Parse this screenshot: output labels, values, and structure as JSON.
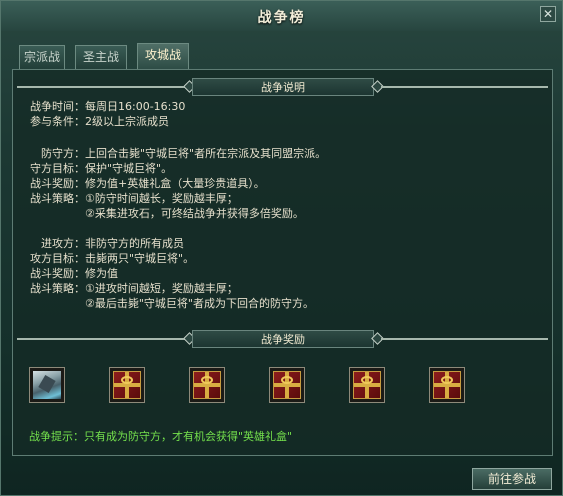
{
  "window": {
    "title": "战争榜",
    "close_label": "✕"
  },
  "tabs": [
    {
      "label": "宗派战",
      "active": false
    },
    {
      "label": "圣主战",
      "active": false
    },
    {
      "label": "攻城战",
      "active": true
    }
  ],
  "description": {
    "header": "战争说明",
    "general": [
      {
        "label": "战争时间：",
        "value": "每周日16:00-16:30"
      },
      {
        "label": "参与条件：",
        "value": "2级以上宗派成员"
      }
    ],
    "defender": [
      {
        "label": "防守方：",
        "value": "上回合击毙\"守城巨将\"者所在宗派及其同盟宗派。"
      },
      {
        "label": "守方目标：",
        "value": "保护\"守城巨将\"。"
      },
      {
        "label": "战斗奖励：",
        "value": "修为值+英雄礼盒（大量珍贵道具）。"
      },
      {
        "label": "战斗策略：",
        "value": "①防守时间越长，奖励越丰厚；"
      },
      {
        "label": "",
        "value": "②采集进攻石，可终结战争并获得多倍奖励。"
      }
    ],
    "attacker": [
      {
        "label": "进攻方：",
        "value": "非防守方的所有成员"
      },
      {
        "label": "攻方目标：",
        "value": "击毙两只\"守城巨将\"。"
      },
      {
        "label": "战斗奖励：",
        "value": "修为值"
      },
      {
        "label": "战斗策略：",
        "value": "①进攻时间越短，奖励越丰厚；"
      },
      {
        "label": "",
        "value": "②最后击毙\"守城巨将\"者成为下回合的防守方。"
      }
    ]
  },
  "rewards": {
    "header": "战争奖励",
    "items": [
      {
        "icon": "crystal-stone-icon"
      },
      {
        "icon": "gift-box-icon"
      },
      {
        "icon": "gift-box-icon"
      },
      {
        "icon": "gift-box-icon"
      },
      {
        "icon": "gift-box-icon"
      },
      {
        "icon": "gift-box-icon"
      }
    ]
  },
  "tip": "战争提示：只有成为防守方，才有机会获得\"英雄礼盒\"",
  "join_button": "前往参战",
  "colors": {
    "tip_text": "#74e04c",
    "panel_bg": "#15302b",
    "accent": "#d8ad42"
  }
}
